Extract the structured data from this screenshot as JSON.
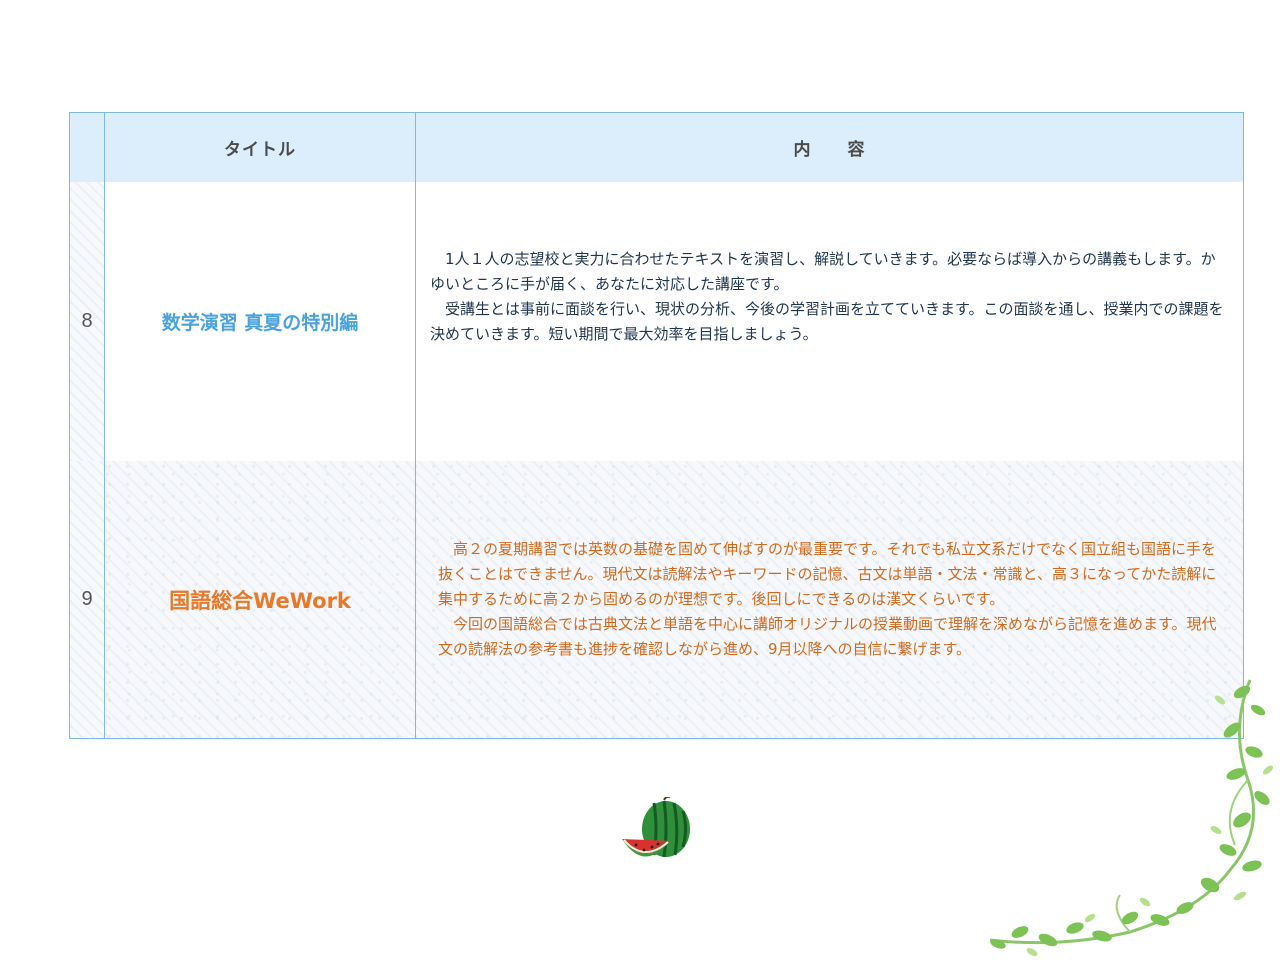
{
  "table": {
    "header": {
      "number": "",
      "title": "タイトル",
      "content": "内　　容"
    },
    "rows": [
      {
        "number": "8",
        "title": "数学演習 真夏の特別編",
        "title_color": "#4aa3df",
        "paragraphs": [
          "1人１人の志望校と実力に合わせたテキストを演習し、解説していきます。必要ならば導入からの講義もします。かゆいところに手が届く、あなたに対応した講座です。",
          "受講生とは事前に面談を行い、現状の分析、今後の学習計画を立てていきます。この面談を通し、授業内での課題を決めていきます。短い期間で最大効率を目指しましょう。"
        ]
      },
      {
        "number": "9",
        "title": "国語総合WeWork",
        "title_color": "#e8782a",
        "paragraphs": [
          "高２の夏期講習では英数の基礎を固めて伸ばすのが最重要です。それでも私立文系だけでなく国立組も国語に手を抜くことはできません。現代文は読解法やキーワードの記憶、古文は単語・文法・常識と、高３になってかた読解に集中するために高２から固めるのが理想です。後回しにできるのは漢文くらいです。",
          "今回の国語総合では古典文法と単語を中心に講師オリジナルの授業動画で理解を深めながら記憶を進めます。現代文の読解法の参考書も進捗を確認しながら進め、9月以降への自信に繋げます。"
        ]
      }
    ]
  },
  "decorations": {
    "watermelon_icon": "watermelon-icon",
    "vine_icon": "vine-decoration"
  }
}
